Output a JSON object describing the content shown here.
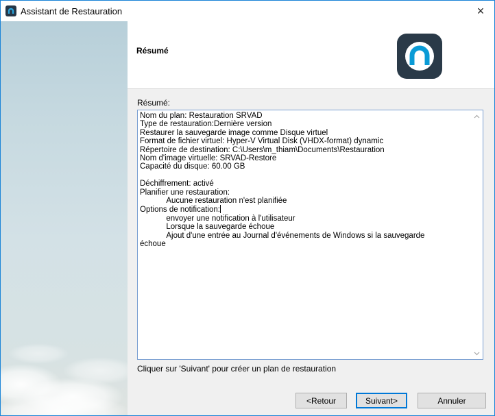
{
  "window": {
    "title": "Assistant de Restauration",
    "close_glyph": "×"
  },
  "header": {
    "title": "Résumé"
  },
  "summary": {
    "label": "Résumé:",
    "lines": [
      "Nom du plan: Restauration SRVAD",
      "Type de restauration:Dernière version",
      "Restaurer la sauvegarde image comme Disque virtuel",
      "Format de fichier virtuel: Hyper-V Virtual Disk (VHDX-format) dynamic",
      "Répertoire de destination: C:\\Users\\m_thiam\\Documents\\Restauration",
      "Nom d'image virtuelle: SRVAD-Restore",
      "Capacité du disque: 60.00 GB",
      "",
      "Déchiffrement: activé",
      "Planifier une restauration:",
      "            Aucune restauration n'est planifiée",
      "Options de notification:",
      "            envoyer une notification à l'utilisateur",
      "            Lorsque la sauvegarde échoue",
      "            Ajout d'une entrée au Journal d'événements de Windows si la sauvegarde",
      "échoue"
    ]
  },
  "footer": {
    "hint": "Cliquer sur 'Suivant' pour créer un plan de restauration"
  },
  "buttons": {
    "back": "<Retour",
    "next": "Suivant>",
    "cancel": "Annuler"
  },
  "colors": {
    "accent": "#0078d7",
    "logo_bg": "#2a3a48",
    "logo_ring": "#0a9bd6"
  }
}
